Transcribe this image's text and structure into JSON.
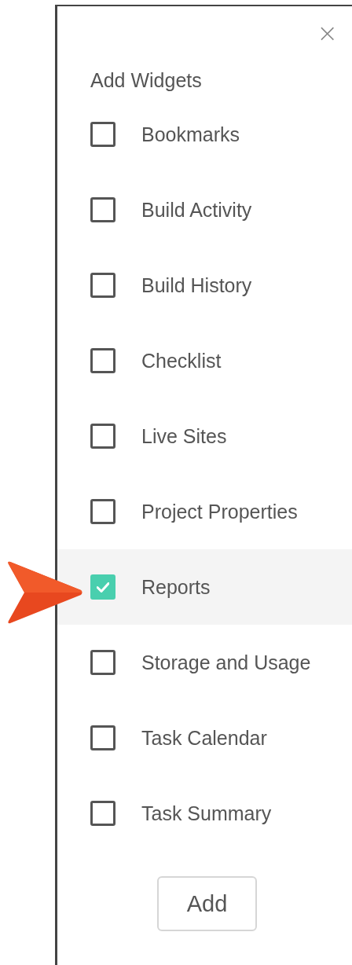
{
  "panel": {
    "title": "Add Widgets",
    "close": "×"
  },
  "widgets": [
    {
      "label": "Bookmarks",
      "checked": false
    },
    {
      "label": "Build Activity",
      "checked": false
    },
    {
      "label": "Build History",
      "checked": false
    },
    {
      "label": "Checklist",
      "checked": false
    },
    {
      "label": "Live Sites",
      "checked": false
    },
    {
      "label": "Project Properties",
      "checked": false
    },
    {
      "label": "Reports",
      "checked": true
    },
    {
      "label": "Storage and Usage",
      "checked": false
    },
    {
      "label": "Task Calendar",
      "checked": false
    },
    {
      "label": "Task Summary",
      "checked": false
    }
  ],
  "buttons": [
    "Add"
  ]
}
